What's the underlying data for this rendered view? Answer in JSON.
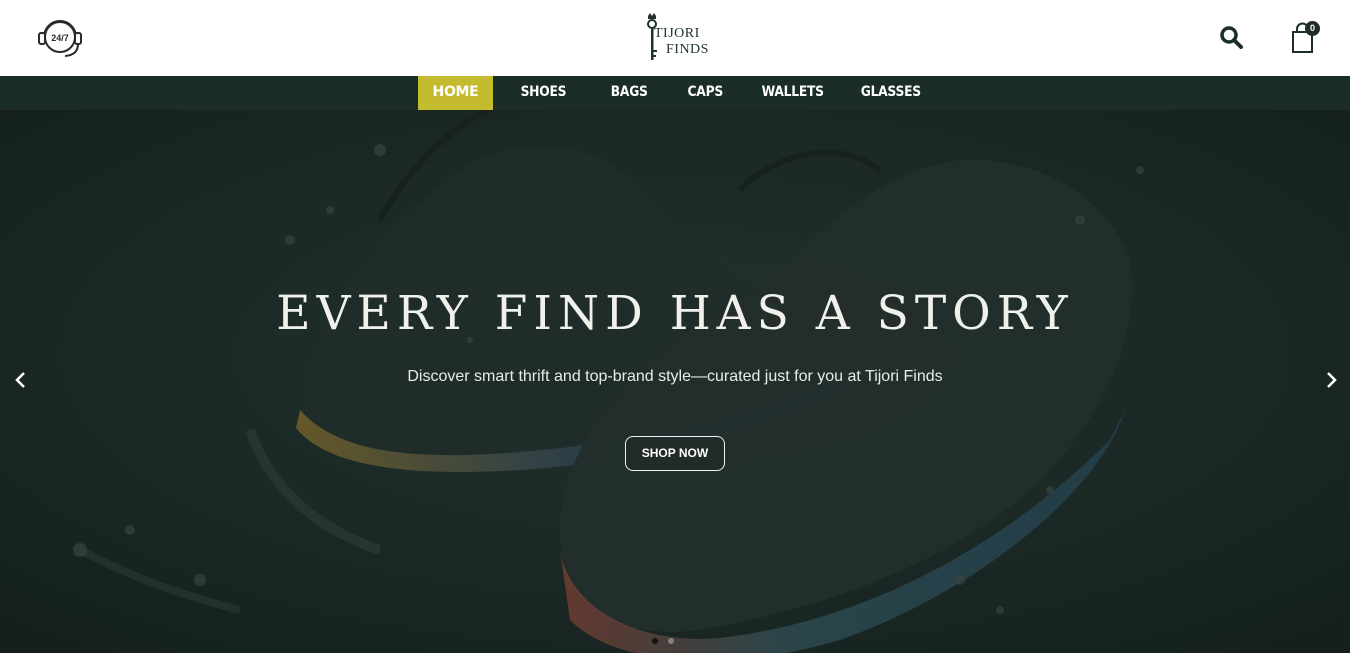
{
  "header": {
    "support_icon": "headset-24-7-icon",
    "logo": {
      "line1": "Tijori",
      "line2": "Finds"
    },
    "search_icon": "search-icon",
    "cart": {
      "icon": "shopping-bag-icon",
      "count": "0"
    }
  },
  "nav": {
    "items": [
      {
        "label": "HOME",
        "active": true
      },
      {
        "label": "SHOES",
        "active": false
      },
      {
        "label": "BAGS",
        "active": false
      },
      {
        "label": "CAPS",
        "active": false
      },
      {
        "label": "WALLETS",
        "active": false
      },
      {
        "label": "GLASSES",
        "active": false
      }
    ]
  },
  "hero": {
    "title": "EVERY FIND HAS A STORY",
    "subtitle": "Discover smart thrift and top-brand style—curated just for you at Tijori Finds",
    "cta": "SHOP NOW",
    "prev_icon": "chevron-left-icon",
    "next_icon": "chevron-right-icon",
    "slide_count": 2,
    "active_slide": 1
  },
  "colors": {
    "nav_bg": "#1b2e26",
    "nav_active": "#c5bb2e",
    "brand_dark": "#1c2e25",
    "hero_overlay": "#1e2b28"
  }
}
